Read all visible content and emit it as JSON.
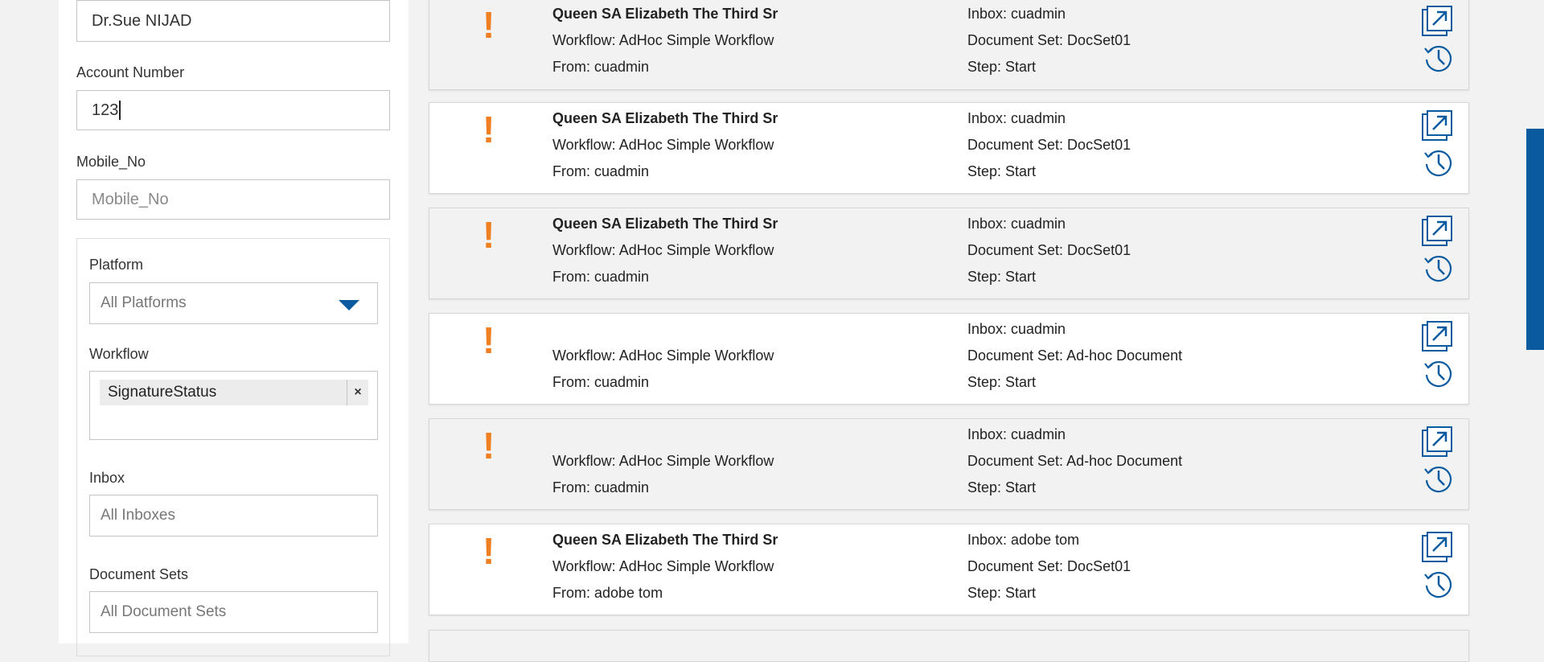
{
  "filters": {
    "name_value": "Dr.Sue NIJAD",
    "account_number_label": "Account Number",
    "account_number_value": "123",
    "mobile_label": "Mobile_No",
    "mobile_placeholder": "Mobile_No",
    "platform_label": "Platform",
    "platform_value": "All Platforms",
    "workflow_label": "Workflow",
    "workflow_tag": "SignatureStatus",
    "workflow_tag_remove": "×",
    "inbox_label": "Inbox",
    "inbox_placeholder": "All Inboxes",
    "document_sets_label": "Document Sets",
    "document_sets_placeholder": "All Document Sets"
  },
  "results": [
    {
      "priority": "!",
      "name": "Queen SA Elizabeth The Third Sr",
      "workflow": "Workflow: AdHoc Simple Workflow",
      "from": "From: cuadmin",
      "inbox": "Inbox: cuadmin",
      "document_set": "Document Set: DocSet01",
      "step": "Step: Start"
    },
    {
      "priority": "!",
      "name": "Queen SA Elizabeth The Third Sr",
      "workflow": "Workflow: AdHoc Simple Workflow",
      "from": "From: cuadmin",
      "inbox": "Inbox: cuadmin",
      "document_set": "Document Set: DocSet01",
      "step": "Step: Start"
    },
    {
      "priority": "!",
      "name": "Queen SA Elizabeth The Third Sr",
      "workflow": "Workflow: AdHoc Simple Workflow",
      "from": "From: cuadmin",
      "inbox": "Inbox: cuadmin",
      "document_set": "Document Set: DocSet01",
      "step": "Step: Start"
    },
    {
      "priority": "!",
      "name": "",
      "workflow": "Workflow: AdHoc Simple Workflow",
      "from": "From: cuadmin",
      "inbox": "Inbox: cuadmin",
      "document_set": "Document Set: Ad-hoc Document",
      "step": "Step: Start"
    },
    {
      "priority": "!",
      "name": "",
      "workflow": "Workflow: AdHoc Simple Workflow",
      "from": "From: cuadmin",
      "inbox": "Inbox: cuadmin",
      "document_set": "Document Set: Ad-hoc Document",
      "step": "Step: Start"
    },
    {
      "priority": "!",
      "name": "Queen SA Elizabeth The Third Sr",
      "workflow": "Workflow: AdHoc Simple Workflow",
      "from": "From: adobe tom",
      "inbox": "Inbox: adobe tom",
      "document_set": "Document Set: DocSet01",
      "step": "Step: Start"
    }
  ],
  "icons": {
    "open": "open-external-icon",
    "history": "history-icon",
    "priority": "exclamation-icon",
    "dropdown": "chevron-down-icon"
  },
  "colors": {
    "accent": "#0a5aa0",
    "priority": "#f07f22"
  }
}
